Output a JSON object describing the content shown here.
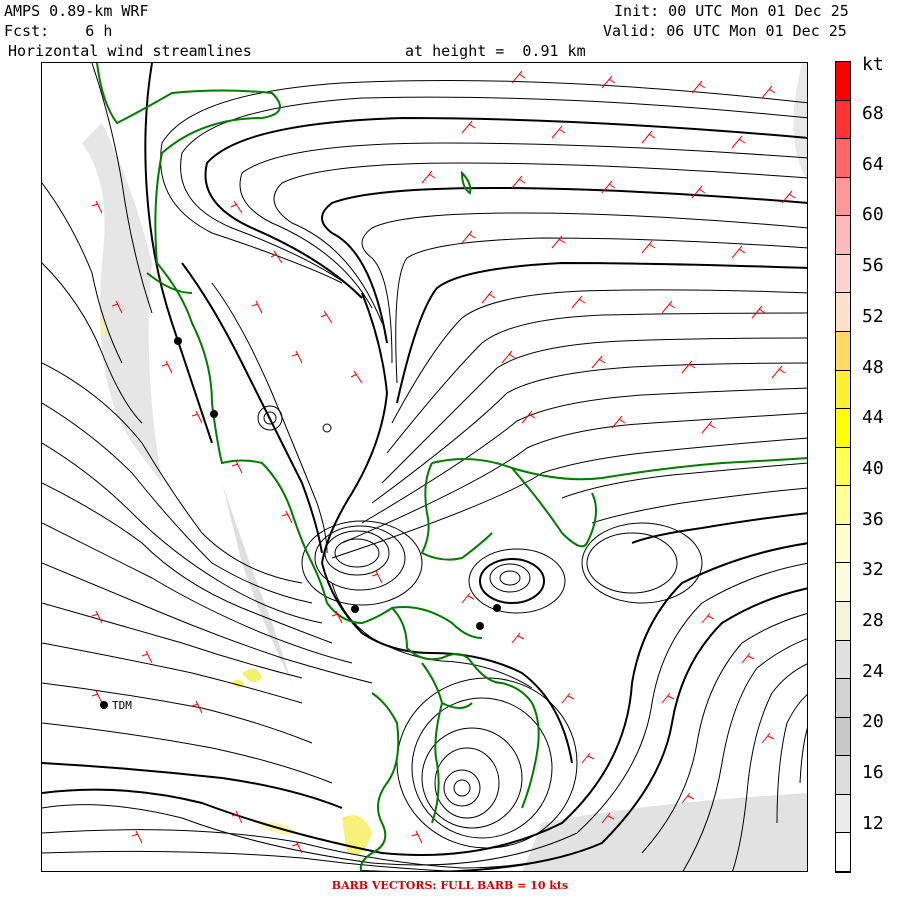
{
  "header": {
    "model": "AMPS 0.89-km WRF",
    "forecast": "Fcst:    6 h",
    "field": "Horizontal wind streamlines",
    "height": "at height =  0.91 km",
    "init": "Init: 00 UTC Mon 01 Dec 25",
    "valid": "Valid: 06 UTC Mon 01 Dec 25"
  },
  "legend": {
    "unit": "kt",
    "labels": [
      "68",
      "64",
      "60",
      "56",
      "52",
      "48",
      "44",
      "40",
      "36",
      "32",
      "28",
      "24",
      "20",
      "16",
      "12"
    ],
    "colors": [
      "#ff0000",
      "#ff3333",
      "#ff6666",
      "#ff9999",
      "#ffbbbb",
      "#ffd2d2",
      "#ffe0c8",
      "#ffd966",
      "#ffee33",
      "#ffff00",
      "#ffff55",
      "#ffff99",
      "#ffffcc",
      "#fefedc",
      "#f4f4d8",
      "#e0e0e0",
      "#d2d2d2",
      "#c8c8c8",
      "#dcdcdc",
      "#ececec",
      "#ffffff"
    ]
  },
  "map": {
    "station": "TDM",
    "coast_color": "#007a00",
    "streamline_color": "#000000",
    "barb_color": "#ff0000"
  },
  "footer": "BARB VECTORS:  FULL BARB = 10 kts"
}
